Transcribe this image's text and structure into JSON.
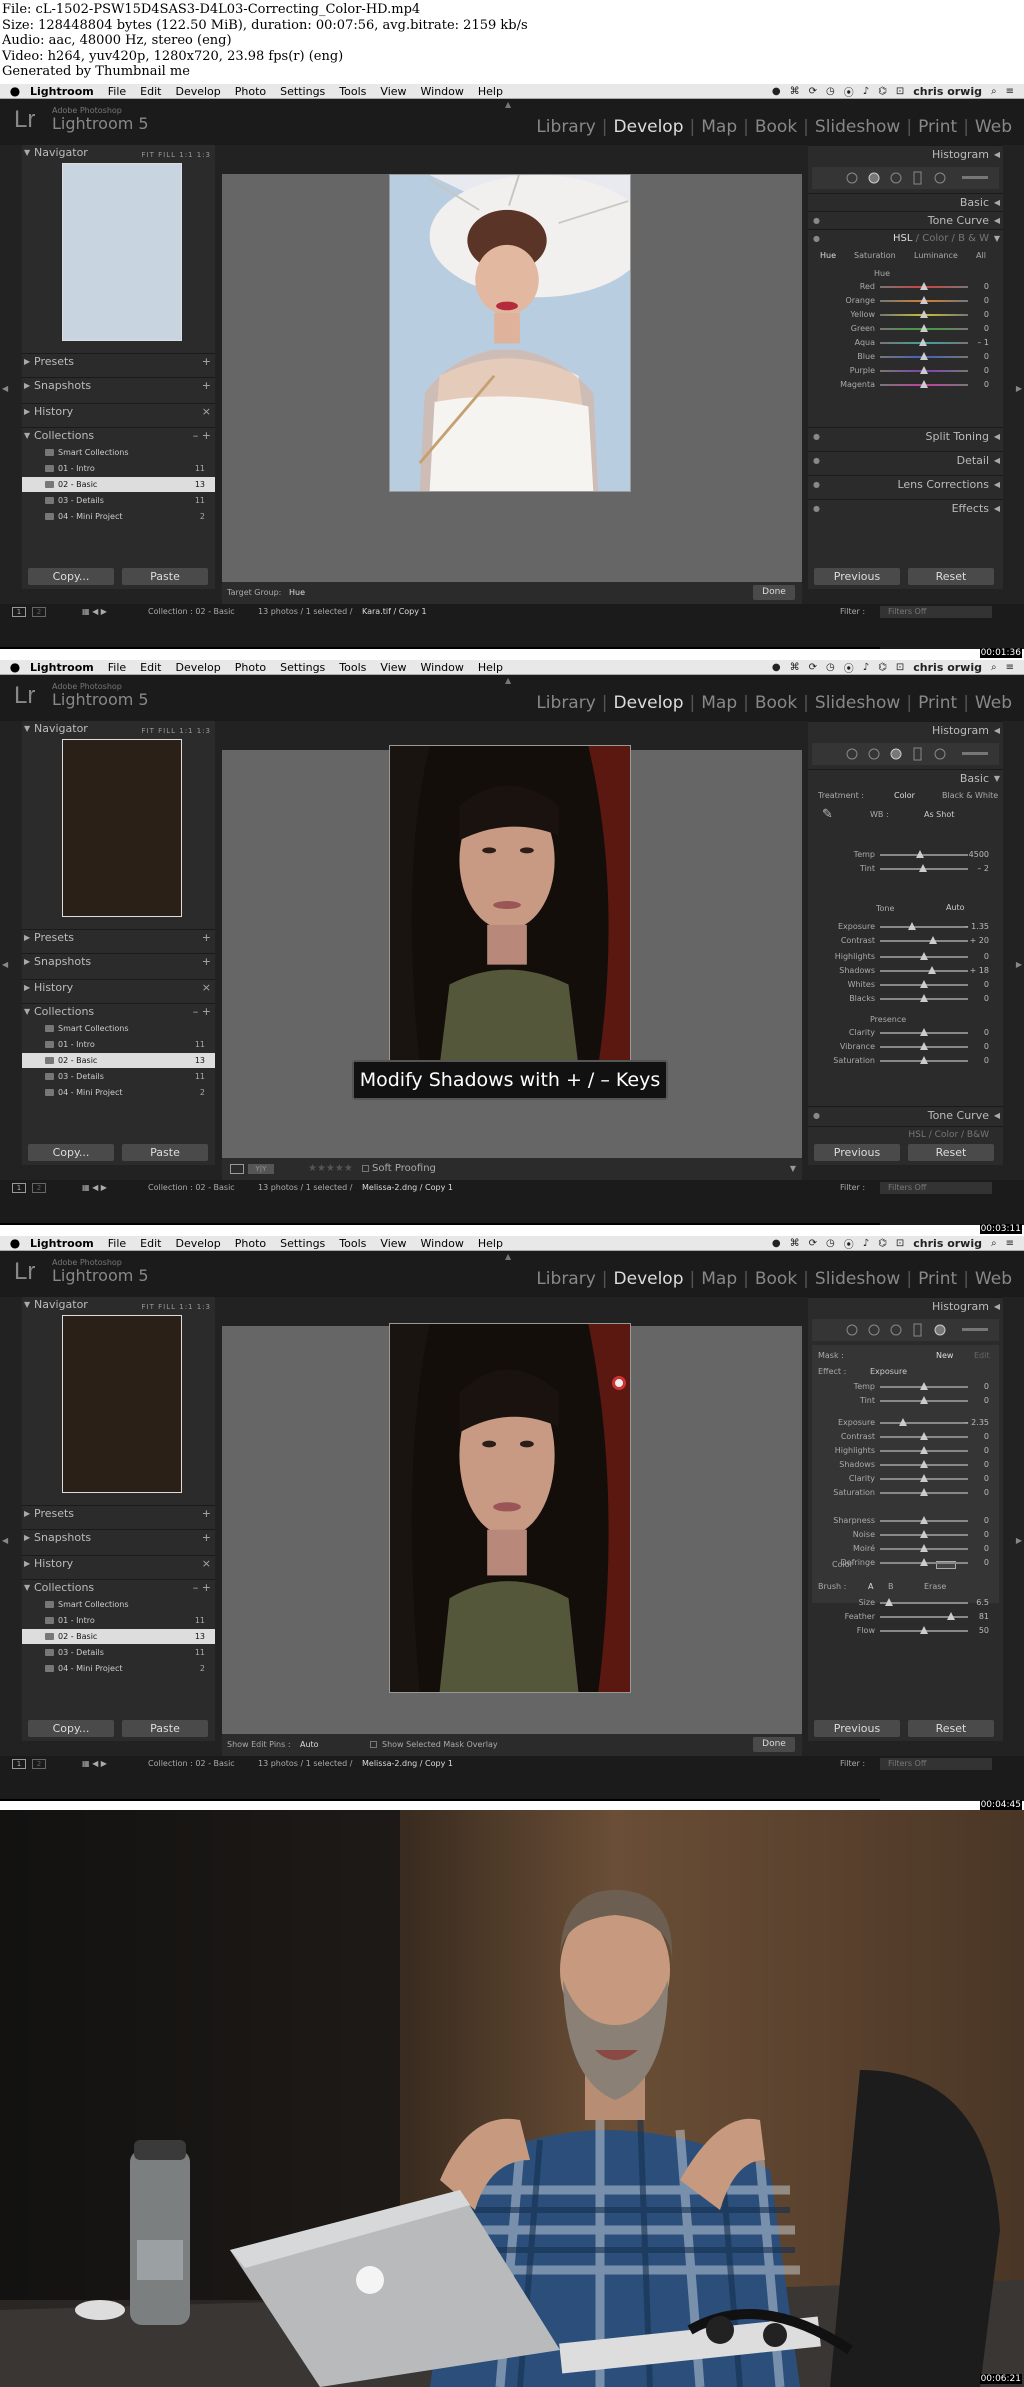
{
  "info": {
    "lines": [
      "File: cL-1502-PSW15D4SAS3-D4L03-Correcting_Color-HD.mp4",
      "Size: 128448804 bytes (122.50 MiB), duration: 00:07:56, avg.bitrate: 2159 kb/s",
      "Audio: aac, 48000 Hz, stereo (eng)",
      "Video: h264, yuv420p, 1280x720, 23.98 fps(r) (eng)",
      "Generated by Thumbnail me"
    ]
  },
  "menubar": {
    "app": "Lightroom",
    "items": [
      "File",
      "Edit",
      "Develop",
      "Photo",
      "Settings",
      "Tools",
      "View",
      "Window",
      "Help"
    ],
    "user": "chris orwig"
  },
  "topbar": {
    "adobe": "Adobe Photoshop",
    "product": "Lightroom 5",
    "logo": "Lr",
    "modules": [
      "Library",
      "Develop",
      "Map",
      "Book",
      "Slideshow",
      "Print",
      "Web"
    ],
    "active": "Develop"
  },
  "left": {
    "navigator": "Navigator",
    "nav_modes": "FIT FILL 1:1 1:3",
    "presets": "Presets",
    "snapshots": "Snapshots",
    "history": "History",
    "collections": "Collections",
    "items": [
      {
        "name": "Smart Collections",
        "count": ""
      },
      {
        "name": "01 - Intro",
        "count": "11"
      },
      {
        "name": "02 - Basic",
        "count": "13"
      },
      {
        "name": "03 - Details",
        "count": "11"
      },
      {
        "name": "04 - Mini Project",
        "count": "2"
      }
    ],
    "copy": "Copy...",
    "paste": "Paste"
  },
  "bottom": {
    "collection": "Collection : 02 - Basic",
    "selected": "13 photos / 1 selected /",
    "filter_label": "Filter :",
    "filter_value": "Filters Off",
    "done": "Done"
  },
  "right": {
    "histogram": "Histogram",
    "previous": "Previous",
    "reset": "Reset"
  },
  "frame1": {
    "timestamp": "00:01:36",
    "file": "Kara.tif / Copy 1",
    "target_label": "Target Group:",
    "target_value": "Hue",
    "panels": {
      "basic": "Basic",
      "tone_curve": "Tone Curve",
      "hsl": "HSL",
      "color": "Color",
      "bw": "B & W",
      "split": "Split Toning",
      "detail": "Detail",
      "lens": "Lens Corrections",
      "effects": "Effects"
    },
    "tabs": [
      "Hue",
      "Saturation",
      "Luminance",
      "All"
    ],
    "hue_title": "Hue",
    "hue": [
      {
        "name": "Red",
        "value": "0",
        "pos": 0.5,
        "color": "#d04040"
      },
      {
        "name": "Orange",
        "value": "0",
        "pos": 0.5,
        "color": "#d08030"
      },
      {
        "name": "Yellow",
        "value": "0",
        "pos": 0.5,
        "color": "#c8c030"
      },
      {
        "name": "Green",
        "value": "0",
        "pos": 0.5,
        "color": "#40a040"
      },
      {
        "name": "Aqua",
        "value": "– 1",
        "pos": 0.49,
        "color": "#40a0a0"
      },
      {
        "name": "Blue",
        "value": "0",
        "pos": 0.5,
        "color": "#4060c0"
      },
      {
        "name": "Purple",
        "value": "0",
        "pos": 0.5,
        "color": "#8040b0"
      },
      {
        "name": "Magenta",
        "value": "0",
        "pos": 0.5,
        "color": "#c040a0"
      }
    ]
  },
  "frame2": {
    "timestamp": "00:03:11",
    "file": "Melissa-2.dng / Copy 1",
    "overlay": "Modify Shadows with + / – Keys",
    "soft_proofing": "Soft Proofing",
    "panels": {
      "basic": "Basic",
      "tone_curve": "Tone Curve",
      "hsl": "HSL / Color / B&W"
    },
    "treatment_label": "Treatment :",
    "treatment_color": "Color",
    "treatment_bw": "Black & White",
    "wb_label": "WB :",
    "wb_value": "As Shot",
    "tone_label": "Tone",
    "auto": "Auto",
    "presence_label": "Presence",
    "sliders": [
      {
        "name": "Temp",
        "value": "4500",
        "pos": 0.45,
        "group": "wb"
      },
      {
        "name": "Tint",
        "value": "– 2",
        "pos": 0.49,
        "group": "wb"
      },
      {
        "name": "Exposure",
        "value": "– 1.35",
        "pos": 0.36,
        "group": "tone"
      },
      {
        "name": "Contrast",
        "value": "+ 20",
        "pos": 0.6,
        "group": "tone"
      },
      {
        "name": "Highlights",
        "value": "0",
        "pos": 0.5,
        "group": "tone2"
      },
      {
        "name": "Shadows",
        "value": "+ 18",
        "pos": 0.59,
        "group": "tone2"
      },
      {
        "name": "Whites",
        "value": "0",
        "pos": 0.5,
        "group": "tone2"
      },
      {
        "name": "Blacks",
        "value": "0",
        "pos": 0.5,
        "group": "tone2"
      },
      {
        "name": "Clarity",
        "value": "0",
        "pos": 0.5,
        "group": "presence"
      },
      {
        "name": "Vibrance",
        "value": "0",
        "pos": 0.5,
        "group": "presence"
      },
      {
        "name": "Saturation",
        "value": "0",
        "pos": 0.5,
        "group": "presence"
      }
    ]
  },
  "frame3": {
    "timestamp": "00:04:45",
    "file": "Melissa-2.dng / Copy 1",
    "show_pins_label": "Show Edit Pins :",
    "show_pins_value": "Auto",
    "mask_overlay": "Show Selected Mask Overlay",
    "mask_label": "Mask :",
    "mask_new": "New",
    "mask_edit": "Edit",
    "effect_label": "Effect :",
    "effect_value": "Exposure",
    "color_label": "Color",
    "brush_label": "Brush :",
    "brush_a": "A",
    "brush_b": "B",
    "brush_erase": "Erase",
    "sliders": [
      {
        "name": "Temp",
        "value": "0",
        "pos": 0.5
      },
      {
        "name": "Tint",
        "value": "0",
        "pos": 0.5
      },
      {
        "name": "Exposure",
        "value": "– 2.35",
        "pos": 0.26
      },
      {
        "name": "Contrast",
        "value": "0",
        "pos": 0.5
      },
      {
        "name": "Highlights",
        "value": "0",
        "pos": 0.5
      },
      {
        "name": "Shadows",
        "value": "0",
        "pos": 0.5
      },
      {
        "name": "Clarity",
        "value": "0",
        "pos": 0.5
      },
      {
        "name": "Saturation",
        "value": "0",
        "pos": 0.5
      },
      {
        "name": "Sharpness",
        "value": "0",
        "pos": 0.5
      },
      {
        "name": "Noise",
        "value": "0",
        "pos": 0.5
      },
      {
        "name": "Moiré",
        "value": "0",
        "pos": 0.5
      },
      {
        "name": "Defringe",
        "value": "0",
        "pos": 0.5
      }
    ],
    "brush": [
      {
        "name": "Size",
        "value": "6.5",
        "pos": 0.1
      },
      {
        "name": "Feather",
        "value": "81",
        "pos": 0.81
      },
      {
        "name": "Flow",
        "value": "50",
        "pos": 0.5
      }
    ]
  },
  "frame4": {
    "timestamp": "00:06:21"
  },
  "colors": {
    "panel": "#2b2b2b",
    "accent": "#ddd"
  }
}
